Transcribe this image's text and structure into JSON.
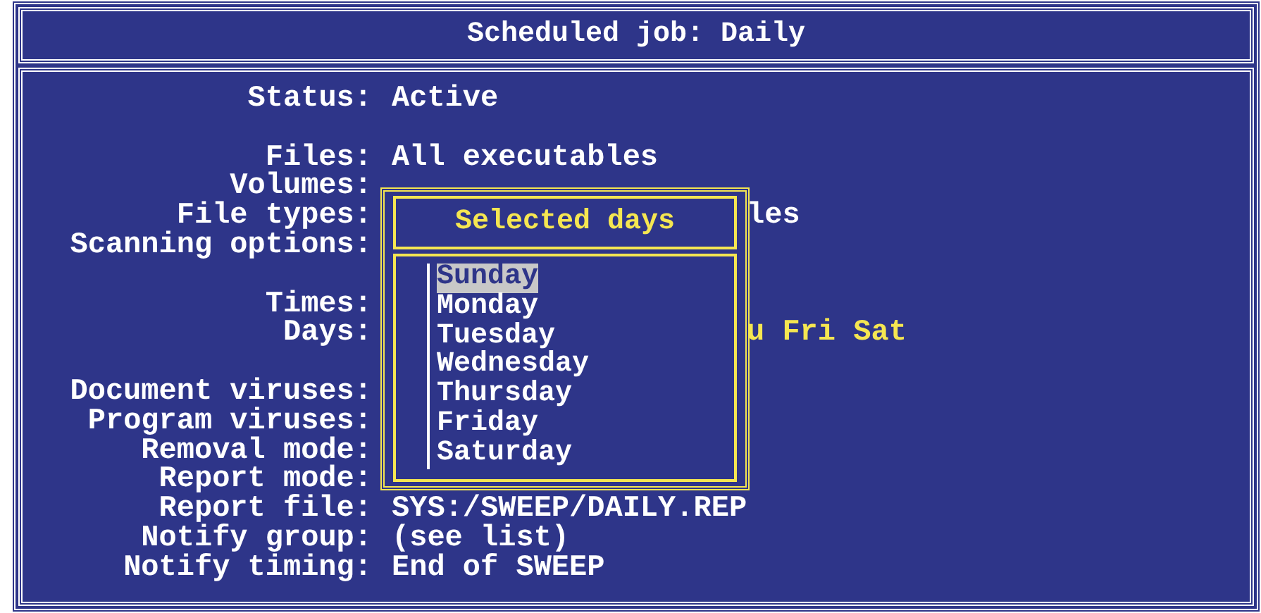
{
  "window": {
    "title": "Scheduled job: Daily"
  },
  "fields": [
    {
      "label": "Status:",
      "value": "Active",
      "kind": "plain",
      "emphasis": false
    },
    {
      "kind": "blank"
    },
    {
      "label": "Files:",
      "value": "All executables",
      "kind": "plain",
      "emphasis": false
    },
    {
      "label": "Volumes:",
      "kind": "plain"
    },
    {
      "label": "File types:",
      "value": "les",
      "kind": "covered",
      "emphasis": false
    },
    {
      "label": "Scanning options:",
      "kind": "plain"
    },
    {
      "kind": "blank"
    },
    {
      "label": "Times:",
      "kind": "plain"
    },
    {
      "label": "Days:",
      "value": "u Fri Sat",
      "kind": "covered",
      "emphasis": true
    },
    {
      "kind": "blank"
    },
    {
      "label": "Document viruses:",
      "kind": "plain"
    },
    {
      "label": "Program viruses:",
      "kind": "plain"
    },
    {
      "label": "Removal mode:",
      "kind": "plain"
    },
    {
      "label": "Report mode:",
      "kind": "plain"
    },
    {
      "label": "Report file:",
      "value": "SYS:/SWEEP/DAILY.REP",
      "kind": "plain",
      "emphasis": false
    },
    {
      "label": "Notify group:",
      "value": "(see list)",
      "kind": "plain",
      "emphasis": false
    },
    {
      "label": "Notify timing:",
      "value": "End of SWEEP",
      "kind": "plain",
      "emphasis": false
    }
  ],
  "popup": {
    "title": "Selected days",
    "items": [
      {
        "label": "Sunday",
        "selected": true
      },
      {
        "label": "Monday",
        "selected": false
      },
      {
        "label": "Tuesday",
        "selected": false
      },
      {
        "label": "Wednesday",
        "selected": false
      },
      {
        "label": "Thursday",
        "selected": false
      },
      {
        "label": "Friday",
        "selected": false
      },
      {
        "label": "Saturday",
        "selected": false
      }
    ]
  }
}
